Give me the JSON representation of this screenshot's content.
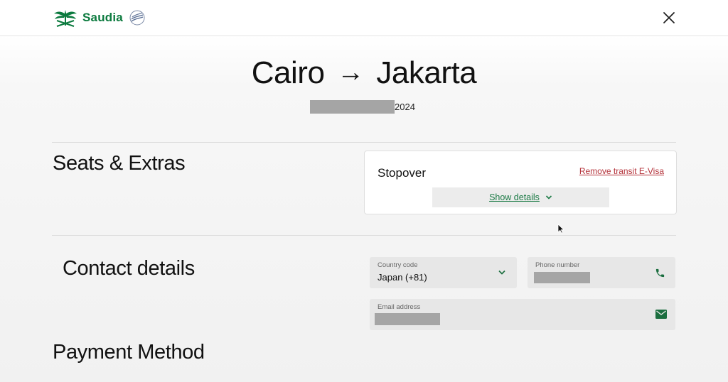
{
  "header": {
    "brand_name": "Saudia",
    "logo_icon": "saudia-palm-swords-logo",
    "alliance_icon": "skyteam-logo",
    "close_icon": "close-icon"
  },
  "trip": {
    "origin": "Cairo",
    "arrow": "→",
    "destination": "Jakarta",
    "date_suffix": "2024"
  },
  "sections": {
    "seats_extras": "Seats & Extras",
    "contact_details": "Contact details",
    "payment_method": "Payment Method"
  },
  "stopover": {
    "title": "Stopover",
    "remove_link": "Remove transit E-Visa",
    "show_details": "Show details"
  },
  "contact": {
    "country_code_label": "Country code",
    "country_code_value": "Japan (+81)",
    "phone_label": "Phone number",
    "email_label": "Email address"
  },
  "colors": {
    "brand_green": "#0b7a3e",
    "link_red": "#b4323a",
    "field_bg": "#e7e7e7"
  }
}
